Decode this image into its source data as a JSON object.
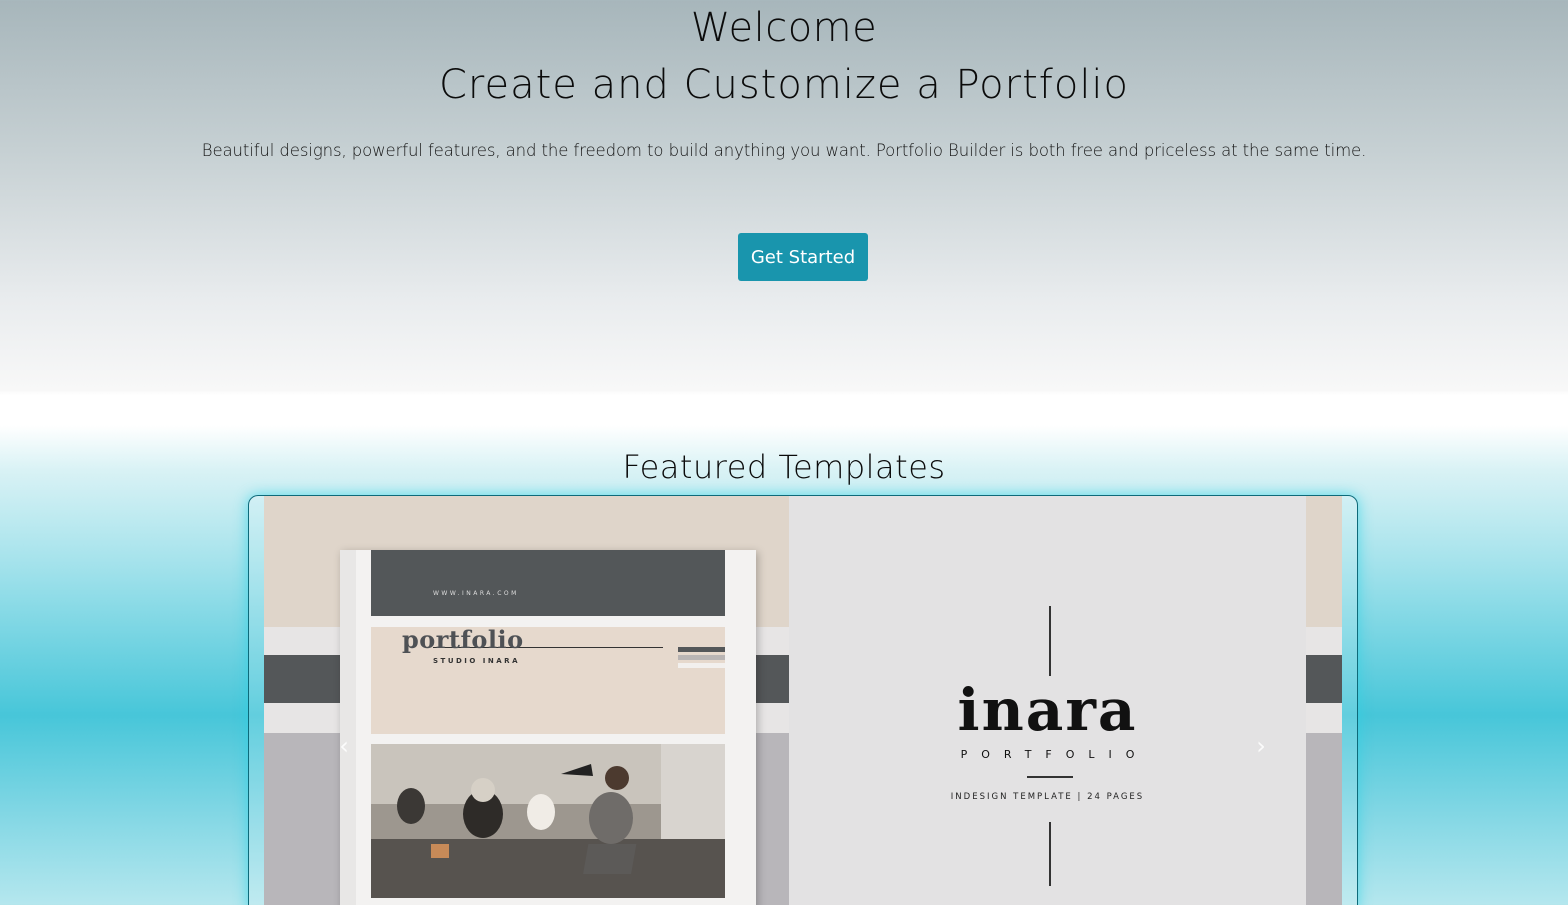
{
  "hero": {
    "welcome": "Welcome",
    "title": "Create and Customize a Portfolio",
    "subtitle": "Beautiful designs, powerful features, and the freedom to build anything you want. Portfolio Builder is both free and priceless at the same time.",
    "cta_label": "Get Started"
  },
  "featured": {
    "heading": "Featured Templates"
  },
  "carousel": {
    "prev_icon": "chevron-left-icon",
    "next_icon": "chevron-right-icon",
    "prev_glyph": "‹",
    "next_glyph": "›",
    "slide": {
      "book_url": "WWW.INARA.COM",
      "book_studio": "STUDIO INARA",
      "book_word": "portfolio",
      "brand": "inara",
      "brand_sub": "PORTFOLIO",
      "brand_meta": "INDESIGN TEMPLATE | 24 PAGES"
    }
  },
  "colors": {
    "cta": "#1995ad",
    "frame_glow": "#28d2e6",
    "book_dark": "#535759",
    "book_beige": "#e6d9cd"
  }
}
